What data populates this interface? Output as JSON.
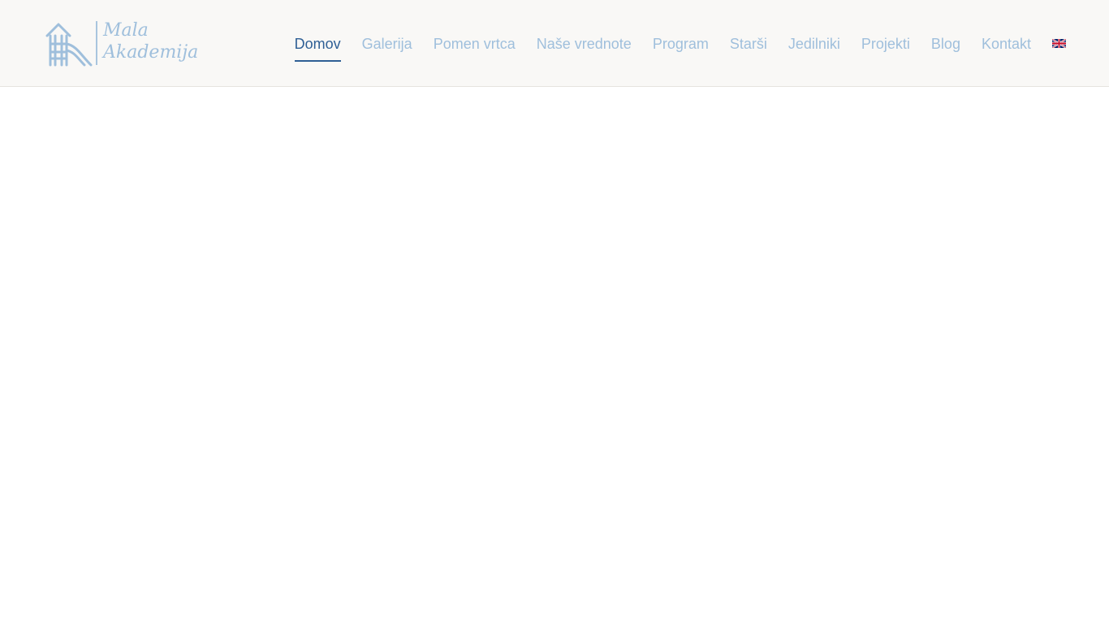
{
  "logo": {
    "line1": "Mala",
    "line2": "Akademija",
    "icon": "playhouse-slide-icon",
    "color": "#9fbfdc"
  },
  "nav": {
    "items": [
      {
        "label": "Domov",
        "active": true
      },
      {
        "label": "Galerija",
        "active": false
      },
      {
        "label": "Pomen vrtca",
        "active": false
      },
      {
        "label": "Naše vrednote",
        "active": false
      },
      {
        "label": "Program",
        "active": false
      },
      {
        "label": "Starši",
        "active": false
      },
      {
        "label": "Jedilniki",
        "active": false
      },
      {
        "label": "Projekti",
        "active": false
      },
      {
        "label": "Blog",
        "active": false
      },
      {
        "label": "Kontakt",
        "active": false
      }
    ],
    "language_icon": "uk-flag-icon",
    "active_color": "#2f5f95",
    "inactive_color": "#9fbfdc"
  }
}
